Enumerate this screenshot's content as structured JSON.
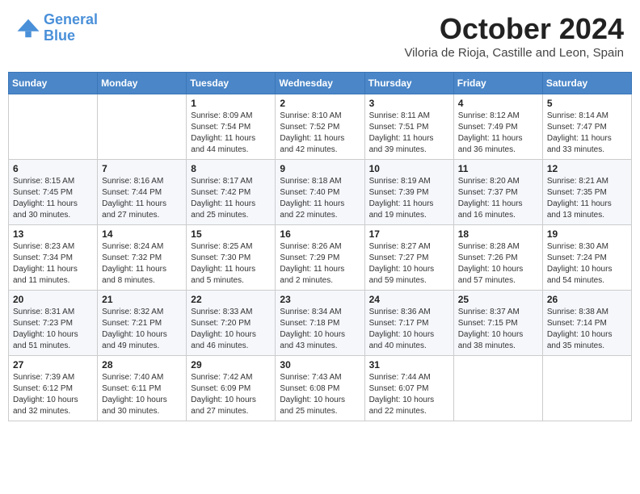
{
  "header": {
    "logo_line1": "General",
    "logo_line2": "Blue",
    "month_title": "October 2024",
    "subtitle": "Viloria de Rioja, Castille and Leon, Spain"
  },
  "days_of_week": [
    "Sunday",
    "Monday",
    "Tuesday",
    "Wednesday",
    "Thursday",
    "Friday",
    "Saturday"
  ],
  "weeks": [
    [
      {
        "day": "",
        "info": ""
      },
      {
        "day": "",
        "info": ""
      },
      {
        "day": "1",
        "info": "Sunrise: 8:09 AM\nSunset: 7:54 PM\nDaylight: 11 hours and 44 minutes."
      },
      {
        "day": "2",
        "info": "Sunrise: 8:10 AM\nSunset: 7:52 PM\nDaylight: 11 hours and 42 minutes."
      },
      {
        "day": "3",
        "info": "Sunrise: 8:11 AM\nSunset: 7:51 PM\nDaylight: 11 hours and 39 minutes."
      },
      {
        "day": "4",
        "info": "Sunrise: 8:12 AM\nSunset: 7:49 PM\nDaylight: 11 hours and 36 minutes."
      },
      {
        "day": "5",
        "info": "Sunrise: 8:14 AM\nSunset: 7:47 PM\nDaylight: 11 hours and 33 minutes."
      }
    ],
    [
      {
        "day": "6",
        "info": "Sunrise: 8:15 AM\nSunset: 7:45 PM\nDaylight: 11 hours and 30 minutes."
      },
      {
        "day": "7",
        "info": "Sunrise: 8:16 AM\nSunset: 7:44 PM\nDaylight: 11 hours and 27 minutes."
      },
      {
        "day": "8",
        "info": "Sunrise: 8:17 AM\nSunset: 7:42 PM\nDaylight: 11 hours and 25 minutes."
      },
      {
        "day": "9",
        "info": "Sunrise: 8:18 AM\nSunset: 7:40 PM\nDaylight: 11 hours and 22 minutes."
      },
      {
        "day": "10",
        "info": "Sunrise: 8:19 AM\nSunset: 7:39 PM\nDaylight: 11 hours and 19 minutes."
      },
      {
        "day": "11",
        "info": "Sunrise: 8:20 AM\nSunset: 7:37 PM\nDaylight: 11 hours and 16 minutes."
      },
      {
        "day": "12",
        "info": "Sunrise: 8:21 AM\nSunset: 7:35 PM\nDaylight: 11 hours and 13 minutes."
      }
    ],
    [
      {
        "day": "13",
        "info": "Sunrise: 8:23 AM\nSunset: 7:34 PM\nDaylight: 11 hours and 11 minutes."
      },
      {
        "day": "14",
        "info": "Sunrise: 8:24 AM\nSunset: 7:32 PM\nDaylight: 11 hours and 8 minutes."
      },
      {
        "day": "15",
        "info": "Sunrise: 8:25 AM\nSunset: 7:30 PM\nDaylight: 11 hours and 5 minutes."
      },
      {
        "day": "16",
        "info": "Sunrise: 8:26 AM\nSunset: 7:29 PM\nDaylight: 11 hours and 2 minutes."
      },
      {
        "day": "17",
        "info": "Sunrise: 8:27 AM\nSunset: 7:27 PM\nDaylight: 10 hours and 59 minutes."
      },
      {
        "day": "18",
        "info": "Sunrise: 8:28 AM\nSunset: 7:26 PM\nDaylight: 10 hours and 57 minutes."
      },
      {
        "day": "19",
        "info": "Sunrise: 8:30 AM\nSunset: 7:24 PM\nDaylight: 10 hours and 54 minutes."
      }
    ],
    [
      {
        "day": "20",
        "info": "Sunrise: 8:31 AM\nSunset: 7:23 PM\nDaylight: 10 hours and 51 minutes."
      },
      {
        "day": "21",
        "info": "Sunrise: 8:32 AM\nSunset: 7:21 PM\nDaylight: 10 hours and 49 minutes."
      },
      {
        "day": "22",
        "info": "Sunrise: 8:33 AM\nSunset: 7:20 PM\nDaylight: 10 hours and 46 minutes."
      },
      {
        "day": "23",
        "info": "Sunrise: 8:34 AM\nSunset: 7:18 PM\nDaylight: 10 hours and 43 minutes."
      },
      {
        "day": "24",
        "info": "Sunrise: 8:36 AM\nSunset: 7:17 PM\nDaylight: 10 hours and 40 minutes."
      },
      {
        "day": "25",
        "info": "Sunrise: 8:37 AM\nSunset: 7:15 PM\nDaylight: 10 hours and 38 minutes."
      },
      {
        "day": "26",
        "info": "Sunrise: 8:38 AM\nSunset: 7:14 PM\nDaylight: 10 hours and 35 minutes."
      }
    ],
    [
      {
        "day": "27",
        "info": "Sunrise: 7:39 AM\nSunset: 6:12 PM\nDaylight: 10 hours and 32 minutes."
      },
      {
        "day": "28",
        "info": "Sunrise: 7:40 AM\nSunset: 6:11 PM\nDaylight: 10 hours and 30 minutes."
      },
      {
        "day": "29",
        "info": "Sunrise: 7:42 AM\nSunset: 6:09 PM\nDaylight: 10 hours and 27 minutes."
      },
      {
        "day": "30",
        "info": "Sunrise: 7:43 AM\nSunset: 6:08 PM\nDaylight: 10 hours and 25 minutes."
      },
      {
        "day": "31",
        "info": "Sunrise: 7:44 AM\nSunset: 6:07 PM\nDaylight: 10 hours and 22 minutes."
      },
      {
        "day": "",
        "info": ""
      },
      {
        "day": "",
        "info": ""
      }
    ]
  ]
}
